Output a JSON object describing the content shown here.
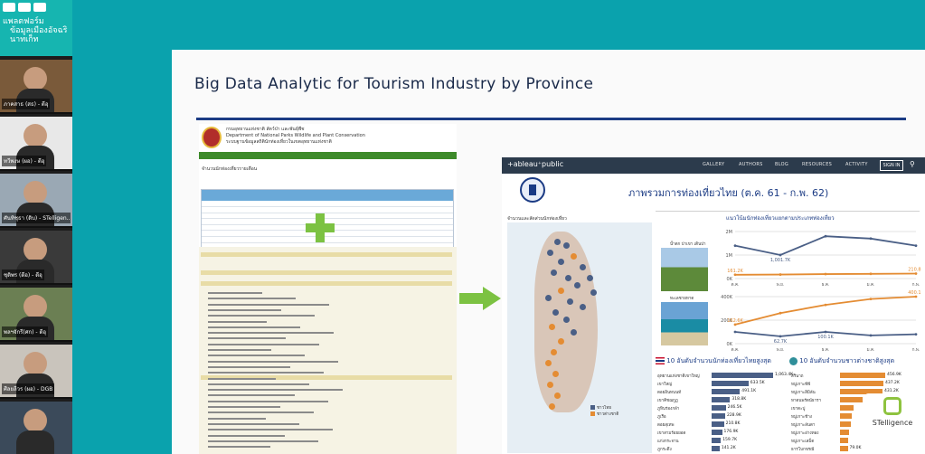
{
  "strip": {
    "header_line1": "แพลตฟอร์ม",
    "header_line2": "ข้อมูลเมืองอัจฉริ",
    "header_line3": "นาทเก็ท",
    "participants": [
      {
        "name": "ภาคสาธ (สธ) - ดีอุ"
      },
      {
        "name": "ทวีพงษ (ผอ) - ดีอุ"
      },
      {
        "name": "ศันทิชุธา (ดิบ) - STelligen..."
      },
      {
        "name": "ชุติพร (ดีอ) - ดีอุ"
      },
      {
        "name": "พลฯจักรี(ศก) - ดีอุ"
      },
      {
        "name": "ศีลยลีวร (ผอ) - DGB"
      },
      {
        "name": ""
      }
    ]
  },
  "slide": {
    "title": "Big Data Analytic for Tourism Industry by Province"
  },
  "doc": {
    "agency_th": "กรมอุทยานแห่งชาติ สัตว์ป่า และพันธุ์พืช",
    "agency_en": "Department of National Parks Wildlife and Plant Conservation",
    "agency_sub": "ระบบฐานข้อมูลสถิตินักท่องเที่ยวในเขตอุทยานแห่งชาติ",
    "table_caption": "จำนวนนักท่องเที่ยวรายเดือน"
  },
  "tableau": {
    "brand": "+ableau⁺public",
    "nav": [
      "GALLERY",
      "AUTHORS",
      "BLOG",
      "RESOURCES",
      "ACTIVITY"
    ],
    "signin": "SIGN IN",
    "title": "ภาพรวมการท่องเที่ยวไทย (ต.ค. 61 - ก.พ. 62)",
    "map_title": "จำนวนและสัดส่วนนักท่องเที่ยว",
    "right_title": "แนวโน้มนักท่องเที่ยวแยกตามประเภทท่องเที่ยว",
    "legend": [
      "ชาวไทย",
      "ชาวต่างชาติ"
    ],
    "legend_colors": [
      "#4a5f86",
      "#e48c33"
    ],
    "photo1_label": "น้ำตก ป่าเขา เดินป่า",
    "photo2_label": "ทะเลชายหาด",
    "panel_left_title": "10 อันดับจำนวนนักท่องเที่ยวไทยสูงสุด",
    "panel_right_title": "10 อันดับจำนวนชาวต่างชาติสูงสุด",
    "left_list": [
      {
        "label": "อุทยานแห่งชาติเขาใหญ่",
        "value": "1,063.4K",
        "frac": 1.0
      },
      {
        "label": "เขาใหญ่",
        "value": "633.5K",
        "frac": 0.6
      },
      {
        "label": "ดอยอินทนนท์",
        "value": "491.1K",
        "frac": 0.46
      },
      {
        "label": "เขาคิชฌกูฏ",
        "value": "318.8K",
        "frac": 0.3
      },
      {
        "label": "ภูหินร่องกล้า",
        "value": "246.5K",
        "frac": 0.23
      },
      {
        "label": "ภูเรือ",
        "value": "228.9K",
        "frac": 0.22
      },
      {
        "label": "ดอยสุเทพ",
        "value": "210.8K",
        "frac": 0.2
      },
      {
        "label": "เขาสามร้อยยอด",
        "value": "176.9K",
        "frac": 0.17
      },
      {
        "label": "แก่งกระจาน",
        "value": "159.7K",
        "frac": 0.15
      },
      {
        "label": "ภูกระดึง",
        "value": "141.2K",
        "frac": 0.13
      }
    ],
    "right_list": [
      {
        "label": "สิรินาถ",
        "value": "456.9K",
        "frac": 1.0
      },
      {
        "label": "หมู่เกาะพีพี",
        "value": "437.2K",
        "frac": 0.96
      },
      {
        "label": "หมู่เกาะสิมิลัน",
        "value": "431.2K",
        "frac": 0.94
      },
      {
        "label": "หาดนพรัตน์ธารา",
        "value": "",
        "frac": 0.5
      },
      {
        "label": "เขาตะปู",
        "value": "",
        "frac": 0.3
      },
      {
        "label": "หมู่เกาะช้าง",
        "value": "",
        "frac": 0.25
      },
      {
        "label": "หมู่เกาะลันตา",
        "value": "",
        "frac": 0.23
      },
      {
        "label": "หมู่เกาะอ่างทอง",
        "value": "",
        "frac": 0.2
      },
      {
        "label": "หมู่เกาะเสม็ด",
        "value": "",
        "frac": 0.18
      },
      {
        "label": "ธารโบกขรณี",
        "value": "79.0K",
        "frac": 0.17
      }
    ],
    "colors": {
      "thai": "#4a5f86",
      "foreign": "#e48c33"
    }
  },
  "chart_data": [
    {
      "type": "line",
      "title": "",
      "x": [
        "ต.ค.",
        "พ.ย.",
        "ธ.ค.",
        "ม.ค.",
        "ก.พ."
      ],
      "ylim": [
        0,
        2000000
      ],
      "yticks": [
        "0K",
        "1M",
        "2M"
      ],
      "series": [
        {
          "name": "ชาวไทย",
          "values": [
            1400000,
            1001700,
            1800000,
            1700000,
            1400000
          ],
          "labels": [
            "",
            "1,001.7K",
            "",
            "",
            ""
          ]
        },
        {
          "name": "ชาวต่างชาติ",
          "values": [
            161200,
            170000,
            190000,
            200000,
            210800
          ],
          "labels": [
            "161.2K",
            "",
            "",
            "",
            "210.8K"
          ]
        }
      ]
    },
    {
      "type": "line",
      "title": "",
      "x": [
        "ต.ค.",
        "พ.ย.",
        "ธ.ค.",
        "ม.ค.",
        "ก.พ."
      ],
      "ylim": [
        0,
        400000
      ],
      "yticks": [
        "0K",
        "200K",
        "400K"
      ],
      "series": [
        {
          "name": "ชาวไทย",
          "values": [
            100000,
            62700,
            100100,
            70000,
            80000
          ],
          "labels": [
            "",
            "62.7K",
            "100.1K",
            "",
            ""
          ]
        },
        {
          "name": "ชาวต่างชาติ",
          "values": [
            162600,
            260000,
            330000,
            380000,
            400000
          ],
          "labels": [
            "162.6K",
            "",
            "",
            "",
            "400.1K"
          ]
        }
      ]
    }
  ],
  "watermark": {
    "text": "STelligence"
  }
}
